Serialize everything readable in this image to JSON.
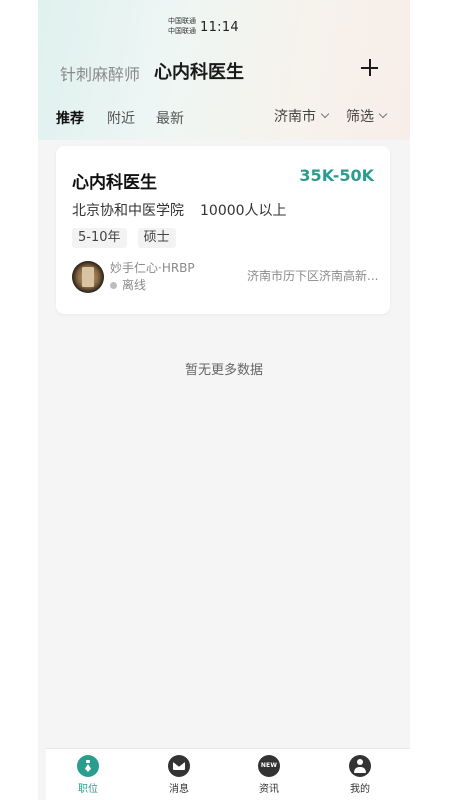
{
  "status_bar": {
    "carrier_1": "中国联通",
    "carrier_2": "中国联通",
    "time": "11:14"
  },
  "header": {
    "inactive_title": "针刺麻醉师",
    "active_title": "心内科医生",
    "add_icon": "plus-icon"
  },
  "filters": {
    "tabs": [
      {
        "label": "推荐",
        "active": true
      },
      {
        "label": "附近",
        "active": false
      },
      {
        "label": "最新",
        "active": false
      }
    ],
    "city": "济南市",
    "filter_label": "筛选"
  },
  "job": {
    "title": "心内科医生",
    "salary": "35K-50K",
    "company": "北京协和中医学院",
    "company_size": "10000人以上",
    "tags": [
      "5-10年",
      "硕士"
    ],
    "recruiter_name": "妙手仁心·HRBP",
    "recruiter_status": "离线",
    "address": "济南市历下区济南高新..."
  },
  "no_more_text": "暂无更多数据",
  "tabbar": {
    "items": [
      {
        "label": "职位",
        "icon": "tie-icon",
        "active": true
      },
      {
        "label": "消息",
        "icon": "mail-icon",
        "active": false
      },
      {
        "label": "资讯",
        "icon": "news-icon",
        "icon_text": "NEW",
        "active": false
      },
      {
        "label": "我的",
        "icon": "user-icon",
        "active": false
      }
    ]
  },
  "colors": {
    "accent": "#2a9d8f",
    "background": "#f5f5f5",
    "card": "#ffffff"
  }
}
